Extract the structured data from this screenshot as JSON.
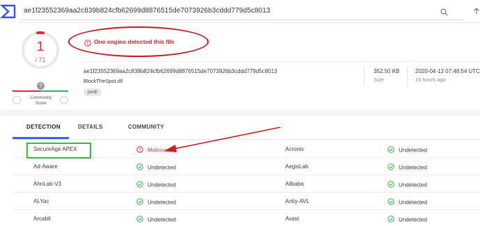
{
  "search": {
    "query": "ae1f23552369aa2c839b824cfb62699d8876515de7073926b3cddd779d5c8013"
  },
  "score": {
    "detected": "1",
    "total": "/ 71"
  },
  "community": {
    "label_line1": "Community",
    "label_line2": "Score",
    "question": "?"
  },
  "alert": {
    "text": "One engine detected this file"
  },
  "file": {
    "hash": "ae1f23552369aa2c839b824cfb62699d8876515de7073926b3cddd779d5c8013",
    "name": "BlockTheSpot.dll",
    "tag": "pedll",
    "size_value": "352.50 KB",
    "size_label": "Size",
    "date_value": "2020-04-12 07:48:54 UTC",
    "date_label": "15 hours ago"
  },
  "tabs": {
    "detection": "DETECTION",
    "details": "DETAILS",
    "community": "COMMUNITY"
  },
  "detections": [
    {
      "engine_left": "SecureAge APEX",
      "result_left": "Malicious",
      "engine_right": "Acronis",
      "result_right": "Undetected"
    },
    {
      "engine_left": "Ad-Aware",
      "result_left": "Undetected",
      "engine_right": "AegisLab",
      "result_right": "Undetected"
    },
    {
      "engine_left": "AhnLab-V3",
      "result_left": "Undetected",
      "engine_right": "Alibaba",
      "result_right": "Undetected"
    },
    {
      "engine_left": "ALYac",
      "result_left": "Undetected",
      "engine_right": "Antiy-AVL",
      "result_right": "Undetected"
    },
    {
      "engine_left": "Arcabit",
      "result_left": "Undetected",
      "engine_right": "Avast",
      "result_right": "Undetected"
    }
  ],
  "colors": {
    "malicious": "#e4263b",
    "clean": "#2fb84a",
    "accent": "#3b61ff",
    "annotation_red": "#c41a1a",
    "annotation_green": "#2fbf2f"
  }
}
